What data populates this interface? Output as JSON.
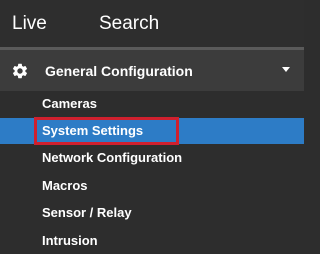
{
  "topnav": {
    "live_label": "Live",
    "search_label": "Search"
  },
  "group": {
    "label": "General Configuration",
    "icon": "gear-icon",
    "expand_icon": "chevron-down-icon",
    "expanded": true
  },
  "menu": {
    "items": [
      {
        "label": "Cameras"
      },
      {
        "label": "System Settings",
        "selected": true
      },
      {
        "label": "Network Configuration"
      },
      {
        "label": "Macros"
      },
      {
        "label": "Sensor / Relay"
      },
      {
        "label": "Intrusion"
      }
    ]
  },
  "colors": {
    "background": "#2d2d2d",
    "header_background": "#3c3c3c",
    "selected_background": "#2d7cc6",
    "highlight_outline": "#d0202e",
    "text": "#ffffff"
  }
}
